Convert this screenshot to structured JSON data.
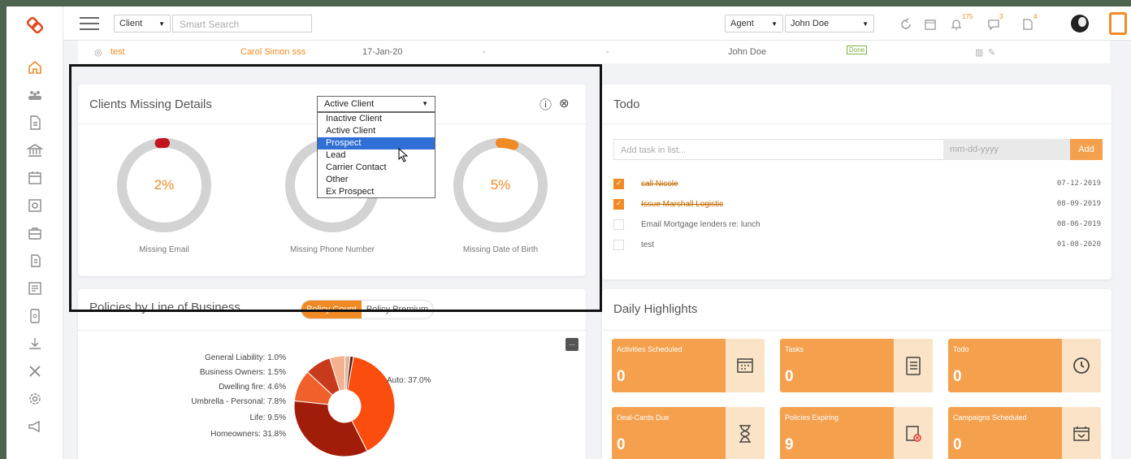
{
  "topbar": {
    "client_select": "Client",
    "search_placeholder": "Smart Search",
    "agent_select": "Agent",
    "user_select": "John Doe",
    "notif_count": "175",
    "msg_count": "3",
    "doc_count": "4"
  },
  "row": {
    "name": "test",
    "contact": "Carol Simon sss",
    "date": "17-Jan-20",
    "dash1": "-",
    "dash2": "-",
    "owner": "John Doe",
    "status": "Done"
  },
  "missing": {
    "title": "Clients Missing Details",
    "dropdown_value": "Active Client",
    "options": [
      "Inactive Client",
      "Active Client",
      "Prospect",
      "Lead",
      "Carrier Contact",
      "Other",
      "Ex Prospect"
    ],
    "selected_option": "Prospect",
    "donuts": [
      {
        "label": "Missing Email",
        "value": "2%",
        "percent": 2
      },
      {
        "label": "Missing Phone Number",
        "value": "",
        "percent": 0
      },
      {
        "label": "Missing Date of Birth",
        "value": "5%",
        "percent": 5
      }
    ]
  },
  "policies": {
    "title": "Policies by Line of Business",
    "toggle_on": "Policy Count",
    "toggle_off": "Policy Premium",
    "menu_icon": "..."
  },
  "chart_data": {
    "type": "pie",
    "title": "",
    "labels": [
      "General Liability: 1.0%",
      "Business Owners: 1.5%",
      "Dwelling fire: 4.6%",
      "Umbrella - Personal: 7.8%",
      "Life: 9.5%",
      "Homeowners: 31.8%",
      "Auto: 37.0%"
    ],
    "categories": [
      "General Liability",
      "Business Owners",
      "Dwelling fire",
      "Umbrella - Personal",
      "Life",
      "Homeowners",
      "Auto"
    ],
    "values": [
      1.0,
      1.5,
      4.6,
      7.8,
      9.5,
      31.8,
      37.0
    ],
    "colors": [
      "#5a1a0e",
      "#d9b59a",
      "#f3b190",
      "#c73a1b",
      "#f0602a",
      "#a11d0a",
      "#fb4d0d"
    ]
  },
  "todo": {
    "title": "Todo",
    "input_placeholder": "Add task in list...",
    "date_placeholder": "mm-dd-yyyy",
    "add_label": "Add",
    "items": [
      {
        "text": "call Nicole",
        "date": "07-12-2019",
        "done": true
      },
      {
        "text": "Issue Marshall Logistic",
        "date": "08-09-2019",
        "done": true
      },
      {
        "text": "Email Mortgage lenders re: lunch",
        "date": "08-06-2019",
        "done": false
      },
      {
        "text": "test",
        "date": "01-08-2020",
        "done": false
      }
    ]
  },
  "highlights": {
    "title": "Daily Highlights",
    "tiles": [
      {
        "name": "Activities Scheduled",
        "value": "0",
        "icon": "calendar-icon"
      },
      {
        "name": "Tasks",
        "value": "0",
        "icon": "clipboard-icon"
      },
      {
        "name": "Todo",
        "value": "0",
        "icon": "clock-icon"
      },
      {
        "name": "Deal-Cards Due",
        "value": "0",
        "icon": "hourglass-icon"
      },
      {
        "name": "Policies Expiring",
        "value": "9",
        "icon": "document-x-icon"
      },
      {
        "name": "Campaigns Scheduled",
        "value": "0",
        "icon": "mail-calendar-icon"
      }
    ]
  },
  "colors": {
    "accent": "#f08a24",
    "tile": "#f5a04d",
    "donut_track": "#d3d3d3",
    "donut_email": "#c0161c",
    "donut_dob": "#f08a24"
  }
}
